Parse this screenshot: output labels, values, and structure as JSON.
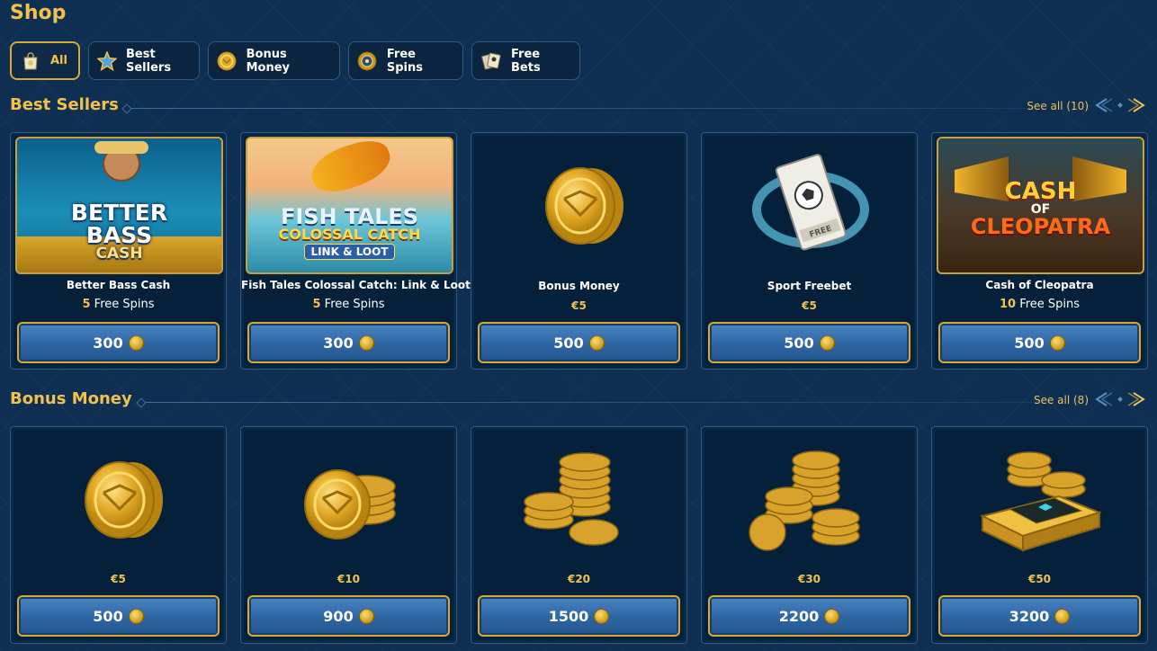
{
  "page": {
    "title": "Shop"
  },
  "tabs": [
    {
      "label": "All",
      "icon": "shopping-bag-icon",
      "active": true
    },
    {
      "label": "Best Sellers",
      "icon": "star-icon"
    },
    {
      "label": "Bonus Money",
      "icon": "coin-icon"
    },
    {
      "label": "Free Spins",
      "icon": "spin-coin-icon"
    },
    {
      "label": "Free Bets",
      "icon": "bet-ticket-icon"
    }
  ],
  "best_sellers": {
    "title": "Best Sellers",
    "see_all": "See all (10)",
    "cards": [
      {
        "name": "Better Bass Cash",
        "count": "5",
        "unit": "Free Spins",
        "price": "300",
        "art": {
          "line1": "BETTER",
          "line2": "BASS",
          "line3": "CASH"
        }
      },
      {
        "name": "Fish Tales Colossal Catch: Link & Loot",
        "count": "5",
        "unit": "Free Spins",
        "price": "300",
        "art": {
          "line1": "FISH TALES",
          "line2": "COLOSSAL CATCH",
          "line3": "LINK & LOOT"
        }
      },
      {
        "name": "Bonus Money",
        "amount": "€5",
        "price": "500"
      },
      {
        "name": "Sport Freebet",
        "amount": "€5",
        "price": "500",
        "art": {
          "ticket": "FREE"
        }
      },
      {
        "name": "Cash of Cleopatra",
        "count": "10",
        "unit": "Free Spins",
        "price": "500",
        "art": {
          "line1": "CASH",
          "line2": "OF",
          "line3": "CLEOPATRA"
        }
      }
    ]
  },
  "bonus_money": {
    "title": "Bonus Money",
    "see_all": "See all (8)",
    "cards": [
      {
        "amount": "€5",
        "price": "500"
      },
      {
        "amount": "€10",
        "price": "900"
      },
      {
        "amount": "€20",
        "price": "1500"
      },
      {
        "amount": "€30",
        "price": "2200"
      },
      {
        "amount": "€50",
        "price": "3200"
      }
    ]
  },
  "colors": {
    "accent": "#f2c14b",
    "background": "#0e2f52",
    "card": "#05203b",
    "button": "#2f68a6"
  }
}
